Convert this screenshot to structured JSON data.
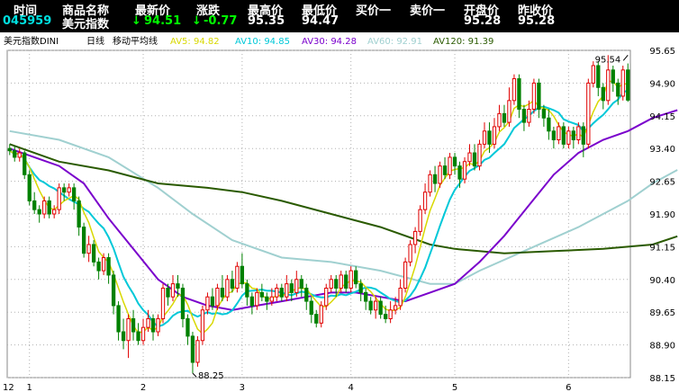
{
  "quote_bar": {
    "headers": [
      "时间",
      "商品名称",
      "最新价",
      "涨跌",
      "最高价",
      "最低价",
      "买价一",
      "卖价一",
      "开盘价",
      "昨收价"
    ],
    "time": "045959",
    "name": "美元指数",
    "last_arrow": "↓",
    "last": "94.51",
    "change_arrow": "↓",
    "change": "-0.77",
    "high": "95.35",
    "low": "94.47",
    "bid": "",
    "ask": "",
    "open": "95.28",
    "prev_close": "95.28"
  },
  "indicator_bar": {
    "symbol": "美元指数DINI",
    "period": "日线",
    "indicator": "移动平均线",
    "ma": [
      {
        "label": "AV5: 94.82",
        "color": "#d8d800"
      },
      {
        "label": "AV10: 94.85",
        "color": "#00c8d8"
      },
      {
        "label": "AV30: 94.28",
        "color": "#7a00cc"
      },
      {
        "label": "AV60: 92.91",
        "color": "#a0d0d0"
      },
      {
        "label": "AV120: 91.39",
        "color": "#2a5a00"
      }
    ]
  },
  "colors": {
    "up": "#e00000",
    "down": "#008000",
    "ma5": "#d8d800",
    "ma10": "#00c8d8",
    "ma30": "#7a00cc",
    "ma60": "#a0d0d0",
    "ma120": "#2a5a00",
    "grid": "#b0b0b0"
  },
  "chart_data": {
    "type": "candlestick",
    "y_ticks": [
      "95.65",
      "94.90",
      "94.15",
      "93.40",
      "92.65",
      "91.90",
      "91.15",
      "90.40",
      "89.65",
      "88.90",
      "88.15"
    ],
    "ylim": [
      88.15,
      95.65
    ],
    "x_tick_labels": [
      {
        "label": "12",
        "index": 0
      },
      {
        "label": "1",
        "index": 4
      },
      {
        "label": "2",
        "index": 27
      },
      {
        "label": "3",
        "index": 47
      },
      {
        "label": "4",
        "index": 69
      },
      {
        "label": "5",
        "index": 90
      },
      {
        "label": "6",
        "index": 113
      }
    ],
    "annotations": [
      {
        "text": "95.54",
        "index": 125,
        "value": 95.54
      },
      {
        "text": "88.25",
        "index": 37,
        "value": 88.25
      }
    ],
    "candles": [
      [
        93.4,
        93.35,
        93.5,
        93.25
      ],
      [
        93.35,
        93.2,
        93.45,
        93.1
      ],
      [
        93.2,
        93.3,
        93.4,
        93.1
      ],
      [
        93.3,
        92.8,
        93.35,
        92.7
      ],
      [
        92.8,
        92.2,
        92.9,
        92.1
      ],
      [
        92.2,
        92.0,
        92.4,
        91.9
      ],
      [
        92.0,
        91.9,
        92.1,
        91.7
      ],
      [
        91.9,
        92.2,
        92.3,
        91.8
      ],
      [
        92.2,
        91.9,
        92.3,
        91.8
      ],
      [
        91.9,
        92.0,
        92.1,
        91.8
      ],
      [
        92.0,
        92.5,
        92.6,
        91.9
      ],
      [
        92.5,
        92.4,
        92.6,
        92.2
      ],
      [
        92.4,
        92.5,
        92.6,
        92.3
      ],
      [
        92.5,
        92.2,
        92.6,
        92.0
      ],
      [
        92.2,
        91.6,
        92.3,
        91.4
      ],
      [
        91.6,
        91.0,
        91.7,
        90.9
      ],
      [
        91.0,
        91.2,
        91.4,
        90.8
      ],
      [
        91.2,
        90.8,
        91.3,
        90.7
      ],
      [
        90.8,
        90.6,
        90.9,
        90.4
      ],
      [
        90.6,
        90.9,
        91.0,
        90.5
      ],
      [
        90.9,
        90.5,
        91.0,
        90.3
      ],
      [
        90.5,
        89.8,
        90.6,
        89.6
      ],
      [
        89.8,
        89.2,
        89.9,
        89.0
      ],
      [
        89.2,
        89.0,
        89.5,
        88.8
      ],
      [
        89.0,
        89.5,
        89.6,
        88.6
      ],
      [
        89.5,
        89.2,
        89.7,
        89.0
      ],
      [
        89.2,
        89.0,
        89.4,
        88.9
      ],
      [
        89.0,
        89.3,
        89.5,
        88.9
      ],
      [
        89.3,
        89.5,
        89.7,
        89.2
      ],
      [
        89.5,
        89.2,
        89.6,
        89.0
      ],
      [
        89.2,
        89.5,
        89.6,
        89.1
      ],
      [
        89.5,
        90.2,
        90.3,
        89.4
      ],
      [
        90.2,
        90.0,
        90.3,
        89.8
      ],
      [
        90.0,
        90.3,
        90.5,
        89.9
      ],
      [
        90.3,
        90.2,
        90.5,
        90.0
      ],
      [
        90.2,
        89.5,
        90.3,
        89.3
      ],
      [
        89.5,
        89.1,
        89.6,
        88.9
      ],
      [
        89.1,
        88.5,
        89.2,
        88.25
      ],
      [
        88.5,
        89.0,
        89.1,
        88.4
      ],
      [
        89.0,
        89.7,
        89.8,
        88.9
      ],
      [
        89.7,
        90.0,
        90.1,
        89.6
      ],
      [
        90.0,
        89.8,
        90.2,
        89.7
      ],
      [
        89.8,
        90.2,
        90.3,
        89.7
      ],
      [
        90.2,
        90.0,
        90.5,
        89.9
      ],
      [
        90.0,
        90.4,
        90.5,
        89.9
      ],
      [
        90.4,
        90.2,
        90.6,
        90.1
      ],
      [
        90.2,
        90.7,
        90.8,
        90.1
      ],
      [
        90.7,
        90.3,
        91.0,
        90.2
      ],
      [
        90.3,
        90.0,
        90.4,
        89.8
      ],
      [
        90.0,
        89.8,
        90.1,
        89.6
      ],
      [
        89.8,
        90.1,
        90.2,
        89.7
      ],
      [
        90.1,
        90.0,
        90.3,
        89.9
      ],
      [
        90.0,
        89.9,
        90.1,
        89.7
      ],
      [
        89.9,
        90.0,
        90.2,
        89.8
      ],
      [
        90.0,
        90.2,
        90.3,
        89.9
      ],
      [
        90.2,
        90.0,
        90.3,
        89.9
      ],
      [
        90.0,
        90.3,
        90.5,
        89.9
      ],
      [
        90.3,
        90.1,
        90.4,
        89.9
      ],
      [
        90.1,
        90.4,
        90.6,
        90.0
      ],
      [
        90.4,
        90.2,
        90.5,
        90.0
      ],
      [
        90.2,
        89.9,
        90.3,
        89.7
      ],
      [
        89.9,
        89.6,
        90.0,
        89.4
      ],
      [
        89.6,
        89.4,
        89.7,
        89.3
      ],
      [
        89.4,
        89.8,
        89.9,
        89.3
      ],
      [
        89.8,
        90.2,
        90.3,
        89.7
      ],
      [
        90.2,
        90.4,
        90.5,
        90.1
      ],
      [
        90.4,
        90.2,
        90.5,
        90.0
      ],
      [
        90.2,
        90.5,
        90.6,
        90.1
      ],
      [
        90.5,
        90.2,
        90.6,
        90.1
      ],
      [
        90.2,
        90.6,
        90.7,
        90.1
      ],
      [
        90.6,
        90.3,
        90.7,
        90.2
      ],
      [
        90.3,
        90.1,
        90.4,
        89.9
      ],
      [
        90.1,
        89.9,
        90.2,
        89.7
      ],
      [
        89.9,
        89.7,
        90.0,
        89.6
      ],
      [
        89.7,
        89.9,
        90.0,
        89.5
      ],
      [
        89.9,
        89.6,
        90.0,
        89.5
      ],
      [
        89.6,
        89.5,
        89.8,
        89.4
      ],
      [
        89.5,
        89.7,
        89.9,
        89.4
      ],
      [
        89.7,
        89.8,
        90.0,
        89.6
      ],
      [
        89.8,
        90.2,
        90.4,
        89.7
      ],
      [
        90.2,
        90.8,
        90.9,
        90.1
      ],
      [
        90.8,
        91.2,
        91.3,
        90.7
      ],
      [
        91.2,
        91.5,
        91.6,
        91.0
      ],
      [
        91.5,
        92.0,
        92.1,
        91.4
      ],
      [
        92.0,
        92.4,
        92.6,
        91.9
      ],
      [
        92.4,
        92.8,
        92.9,
        92.3
      ],
      [
        92.8,
        92.6,
        93.0,
        92.4
      ],
      [
        92.6,
        93.0,
        93.1,
        92.5
      ],
      [
        93.0,
        92.8,
        93.2,
        92.7
      ],
      [
        92.8,
        93.2,
        93.3,
        92.7
      ],
      [
        93.2,
        93.0,
        93.3,
        92.8
      ],
      [
        93.0,
        92.7,
        93.1,
        92.5
      ],
      [
        92.7,
        93.1,
        93.2,
        92.6
      ],
      [
        93.1,
        93.3,
        93.5,
        93.0
      ],
      [
        93.3,
        93.0,
        93.5,
        92.9
      ],
      [
        93.0,
        93.5,
        93.6,
        92.9
      ],
      [
        93.5,
        93.8,
        94.0,
        93.4
      ],
      [
        93.8,
        93.5,
        94.0,
        93.3
      ],
      [
        93.5,
        93.9,
        94.1,
        93.4
      ],
      [
        93.9,
        94.2,
        94.4,
        93.8
      ],
      [
        94.2,
        94.0,
        94.4,
        93.9
      ],
      [
        94.0,
        94.5,
        94.8,
        93.9
      ],
      [
        94.5,
        95.0,
        95.1,
        94.4
      ],
      [
        95.0,
        94.3,
        95.1,
        94.1
      ],
      [
        94.3,
        94.0,
        94.4,
        93.8
      ],
      [
        94.0,
        94.3,
        94.5,
        93.9
      ],
      [
        94.3,
        94.9,
        95.0,
        94.2
      ],
      [
        94.9,
        94.3,
        95.0,
        94.1
      ],
      [
        94.3,
        94.1,
        94.4,
        93.9
      ],
      [
        94.1,
        93.8,
        94.3,
        93.6
      ],
      [
        93.8,
        93.6,
        93.9,
        93.4
      ],
      [
        93.6,
        93.9,
        94.0,
        93.5
      ],
      [
        93.9,
        93.5,
        94.0,
        93.4
      ],
      [
        93.5,
        93.8,
        93.9,
        93.4
      ],
      [
        93.8,
        93.6,
        93.9,
        93.4
      ],
      [
        93.6,
        93.9,
        94.0,
        93.5
      ],
      [
        93.9,
        93.5,
        94.0,
        93.2
      ],
      [
        93.5,
        94.9,
        95.0,
        93.4
      ],
      [
        94.9,
        95.3,
        95.4,
        94.8
      ],
      [
        95.3,
        94.8,
        95.4,
        94.6
      ],
      [
        94.8,
        94.5,
        94.9,
        94.3
      ],
      [
        94.5,
        95.2,
        95.54,
        94.4
      ],
      [
        95.2,
        94.9,
        95.3,
        94.7
      ],
      [
        94.9,
        94.6,
        95.0,
        94.4
      ],
      [
        94.6,
        95.2,
        95.3,
        94.5
      ],
      [
        95.2,
        94.51,
        95.35,
        94.47
      ]
    ],
    "ma60": [
      [
        0,
        93.8
      ],
      [
        10,
        93.6
      ],
      [
        20,
        93.2
      ],
      [
        30,
        92.5
      ],
      [
        37,
        91.9
      ],
      [
        45,
        91.3
      ],
      [
        55,
        90.9
      ],
      [
        65,
        90.8
      ],
      [
        75,
        90.6
      ],
      [
        85,
        90.3
      ],
      [
        90,
        90.3
      ],
      [
        95,
        90.6
      ],
      [
        105,
        91.1
      ],
      [
        115,
        91.6
      ],
      [
        125,
        92.2
      ],
      [
        130,
        92.6
      ],
      [
        135,
        92.91
      ]
    ],
    "ma120": [
      [
        0,
        93.5
      ],
      [
        10,
        93.1
      ],
      [
        20,
        92.9
      ],
      [
        30,
        92.6
      ],
      [
        40,
        92.5
      ],
      [
        47,
        92.4
      ],
      [
        55,
        92.2
      ],
      [
        65,
        91.9
      ],
      [
        75,
        91.6
      ],
      [
        85,
        91.2
      ],
      [
        90,
        91.1
      ],
      [
        100,
        91.0
      ],
      [
        110,
        91.05
      ],
      [
        120,
        91.1
      ],
      [
        130,
        91.2
      ],
      [
        135,
        91.39
      ]
    ],
    "ma30": [
      [
        0,
        93.4
      ],
      [
        5,
        93.2
      ],
      [
        10,
        93.0
      ],
      [
        15,
        92.6
      ],
      [
        20,
        91.8
      ],
      [
        25,
        91.1
      ],
      [
        30,
        90.4
      ],
      [
        35,
        90.0
      ],
      [
        40,
        89.8
      ],
      [
        45,
        89.7
      ],
      [
        50,
        89.8
      ],
      [
        55,
        89.9
      ],
      [
        60,
        90.0
      ],
      [
        65,
        90.1
      ],
      [
        70,
        90.1
      ],
      [
        75,
        90.0
      ],
      [
        80,
        89.9
      ],
      [
        85,
        90.1
      ],
      [
        90,
        90.3
      ],
      [
        95,
        90.8
      ],
      [
        100,
        91.4
      ],
      [
        105,
        92.1
      ],
      [
        110,
        92.8
      ],
      [
        115,
        93.3
      ],
      [
        120,
        93.6
      ],
      [
        125,
        93.8
      ],
      [
        130,
        94.1
      ],
      [
        135,
        94.28
      ]
    ]
  }
}
